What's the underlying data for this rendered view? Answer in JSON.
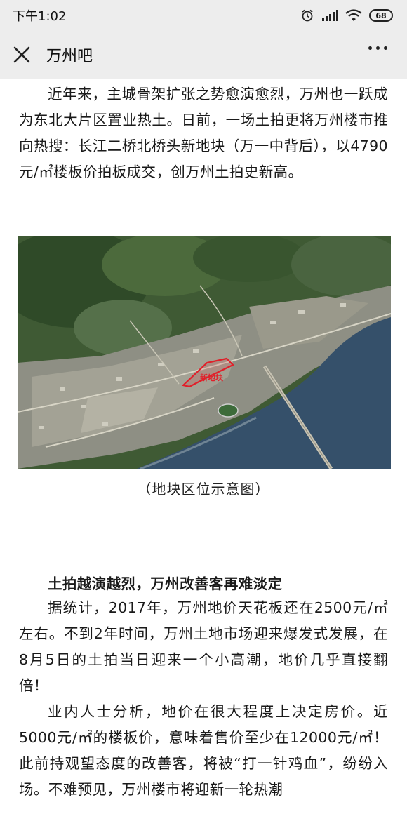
{
  "status_bar": {
    "time": "下午1:02",
    "battery": "68"
  },
  "nav": {
    "title": "万州吧"
  },
  "article": {
    "para1": "近年来，主城骨架扩张之势愈演愈烈，万州也一跃成为东北大片区置业热土。日前，一场土拍更将万州楼市推向热搜：长江二桥北桥头新地块（万一中背后），以4790元/㎡楼板价拍板成交，创万州土拍史新高。",
    "map_label": "新地块",
    "caption": "（地块区位示意图）",
    "heading": "土拍越演越烈，万州改善客再难淡定",
    "para2": "据统计，2017年，万州地价天花板还在2500元/㎡左右。不到2年时间，万州土地市场迎来爆发式发展，在8月5日的土拍当日迎来一个小高潮，地价几乎直接翻倍！",
    "para3": "业内人士分析，地价在很大程度上决定房价。近5000元/㎡的楼板价，意味着售价至少在12000元/㎡！此前持观望态度的改善客，将被“打一针鸡血”，纷纷入场。不难预见，万州楼市将迎新一轮热潮"
  },
  "colors": {
    "bar_bg": "#ededed",
    "river": "#35506a",
    "highlight": "#e0202a"
  }
}
